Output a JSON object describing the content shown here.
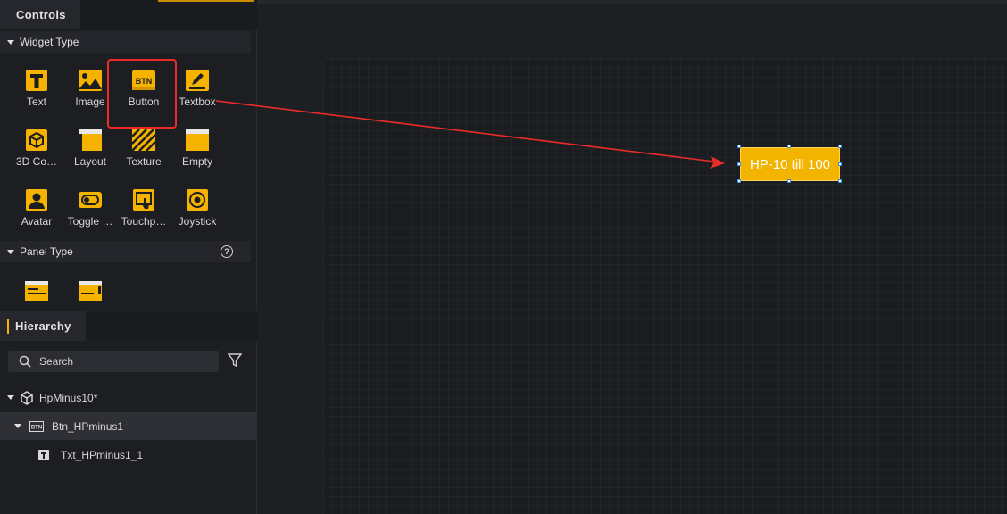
{
  "controls_tab": "Controls",
  "widget_section": "Widget Type",
  "widgets": [
    "Text",
    "Image",
    "Button",
    "Textbox",
    "3D Co…",
    "Layout",
    "Texture",
    "Empty",
    "Avatar",
    "Toggle …",
    "Touchp…",
    "Joystick"
  ],
  "panel_section": "Panel Type",
  "panel_help": "?",
  "hierarchy_tab": "Hierarchy",
  "search_placeholder": "Search",
  "tree": {
    "root": "HpMinus10*",
    "child": "Btn_HPminus1",
    "grandchild": "Txt_HPminus1_1"
  },
  "button_icon_text": "BTN",
  "canvas_button_label": "HP-10 till 100",
  "colors": {
    "accent": "#f5b300",
    "annotation": "#ec2b2b"
  }
}
